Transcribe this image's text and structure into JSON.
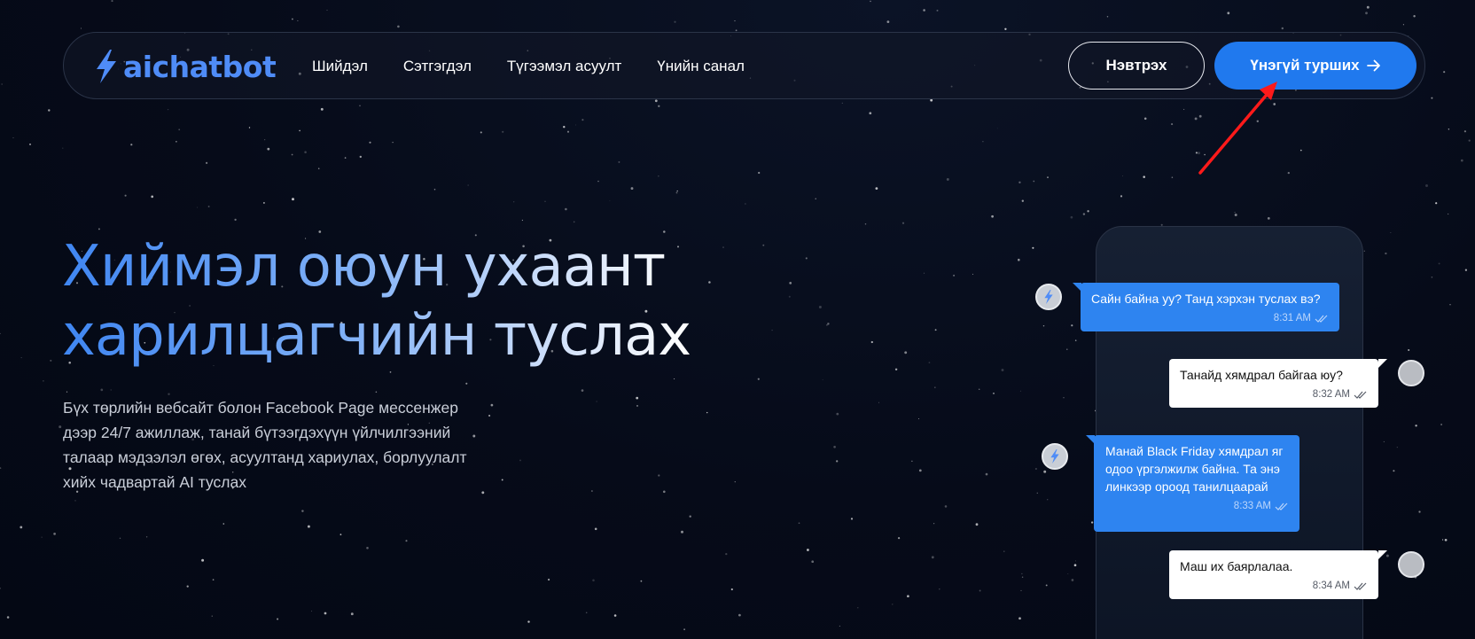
{
  "nav": {
    "logo_text": "aichatbot",
    "links": [
      "Шийдэл",
      "Сэтгэгдэл",
      "Түгээмэл асуулт",
      "Үнийн санал"
    ],
    "login_label": "Нэвтрэх",
    "try_label": "Үнэгүй турших"
  },
  "hero": {
    "title_line1": "Хиймэл оюун ухаант",
    "title_line2": "харилцагчийн туслах",
    "description": "Бүх төрлийн вебсайт болон Facebook Page мессенжер дээр 24/7 ажиллаж, танай бүтээгдэхүүн үйлчилгээний талаар мэдээлэл өгөх, асуултанд хариулах, борлуулалт хийх чадвартай AI туслах"
  },
  "chat": {
    "messages": [
      {
        "from": "bot",
        "text": "Сайн байна уу? Танд хэрхэн туслах вэ?",
        "time": "8:31 AM"
      },
      {
        "from": "user",
        "text": "Танайд хямдрал байгаа юу?",
        "time": "8:32 AM"
      },
      {
        "from": "bot",
        "text": "Манай Black Friday хямдрал яг одоо үргэлжилж байна. Та энэ линкээр ороод танилцаарай",
        "time": "8:33 AM"
      },
      {
        "from": "user",
        "text": "Маш их баярлалаа.",
        "time": "8:34 AM"
      }
    ]
  },
  "colors": {
    "accent": "#2079ee",
    "bot_bubble": "#2e84f0",
    "annotation_arrow": "#ff1a1a"
  },
  "icons": {
    "logo": "lightning-bolt-icon",
    "try_button": "arrow-right-icon",
    "read_receipt": "double-check-icon",
    "bot_avatar": "lightning-bolt-icon"
  }
}
